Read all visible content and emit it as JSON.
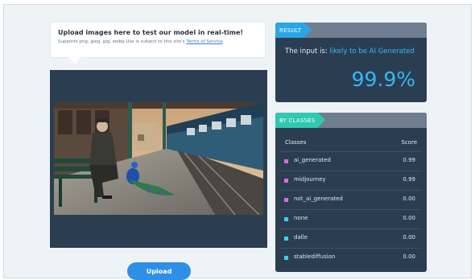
{
  "upload": {
    "title": "Upload images here to test our model in real-time!",
    "subtitle": "Supports png, jpeg, jpg, webp Use is subject to this site's ",
    "tos_link": "Terms of Service",
    "button_label": "Upload"
  },
  "result": {
    "header": "RESULT",
    "input_prefix": "The input is: ",
    "verdict": "likely to be AI Generated",
    "percent": "99.9%"
  },
  "classes": {
    "header": "BY CLASSES",
    "col_classes": "Classes",
    "col_score": "Score",
    "rows": [
      {
        "label": "ai_generated",
        "score": "0.99",
        "color": "#e06ad6"
      },
      {
        "label": "midjourney",
        "score": "0.99",
        "color": "#e06ad6"
      },
      {
        "label": "not_ai_generated",
        "score": "0.00",
        "color": "#e06ad6"
      },
      {
        "label": "none",
        "score": "0.00",
        "color": "#39d3e6"
      },
      {
        "label": "dalle",
        "score": "0.00",
        "color": "#39d3e6"
      },
      {
        "label": "stablediffusion",
        "score": "0.00",
        "color": "#39d3e6"
      }
    ]
  },
  "colors": {
    "accent_blue": "#35b7f5",
    "panel_dark": "#2b3e51",
    "upload_button": "#2f8fe6"
  }
}
